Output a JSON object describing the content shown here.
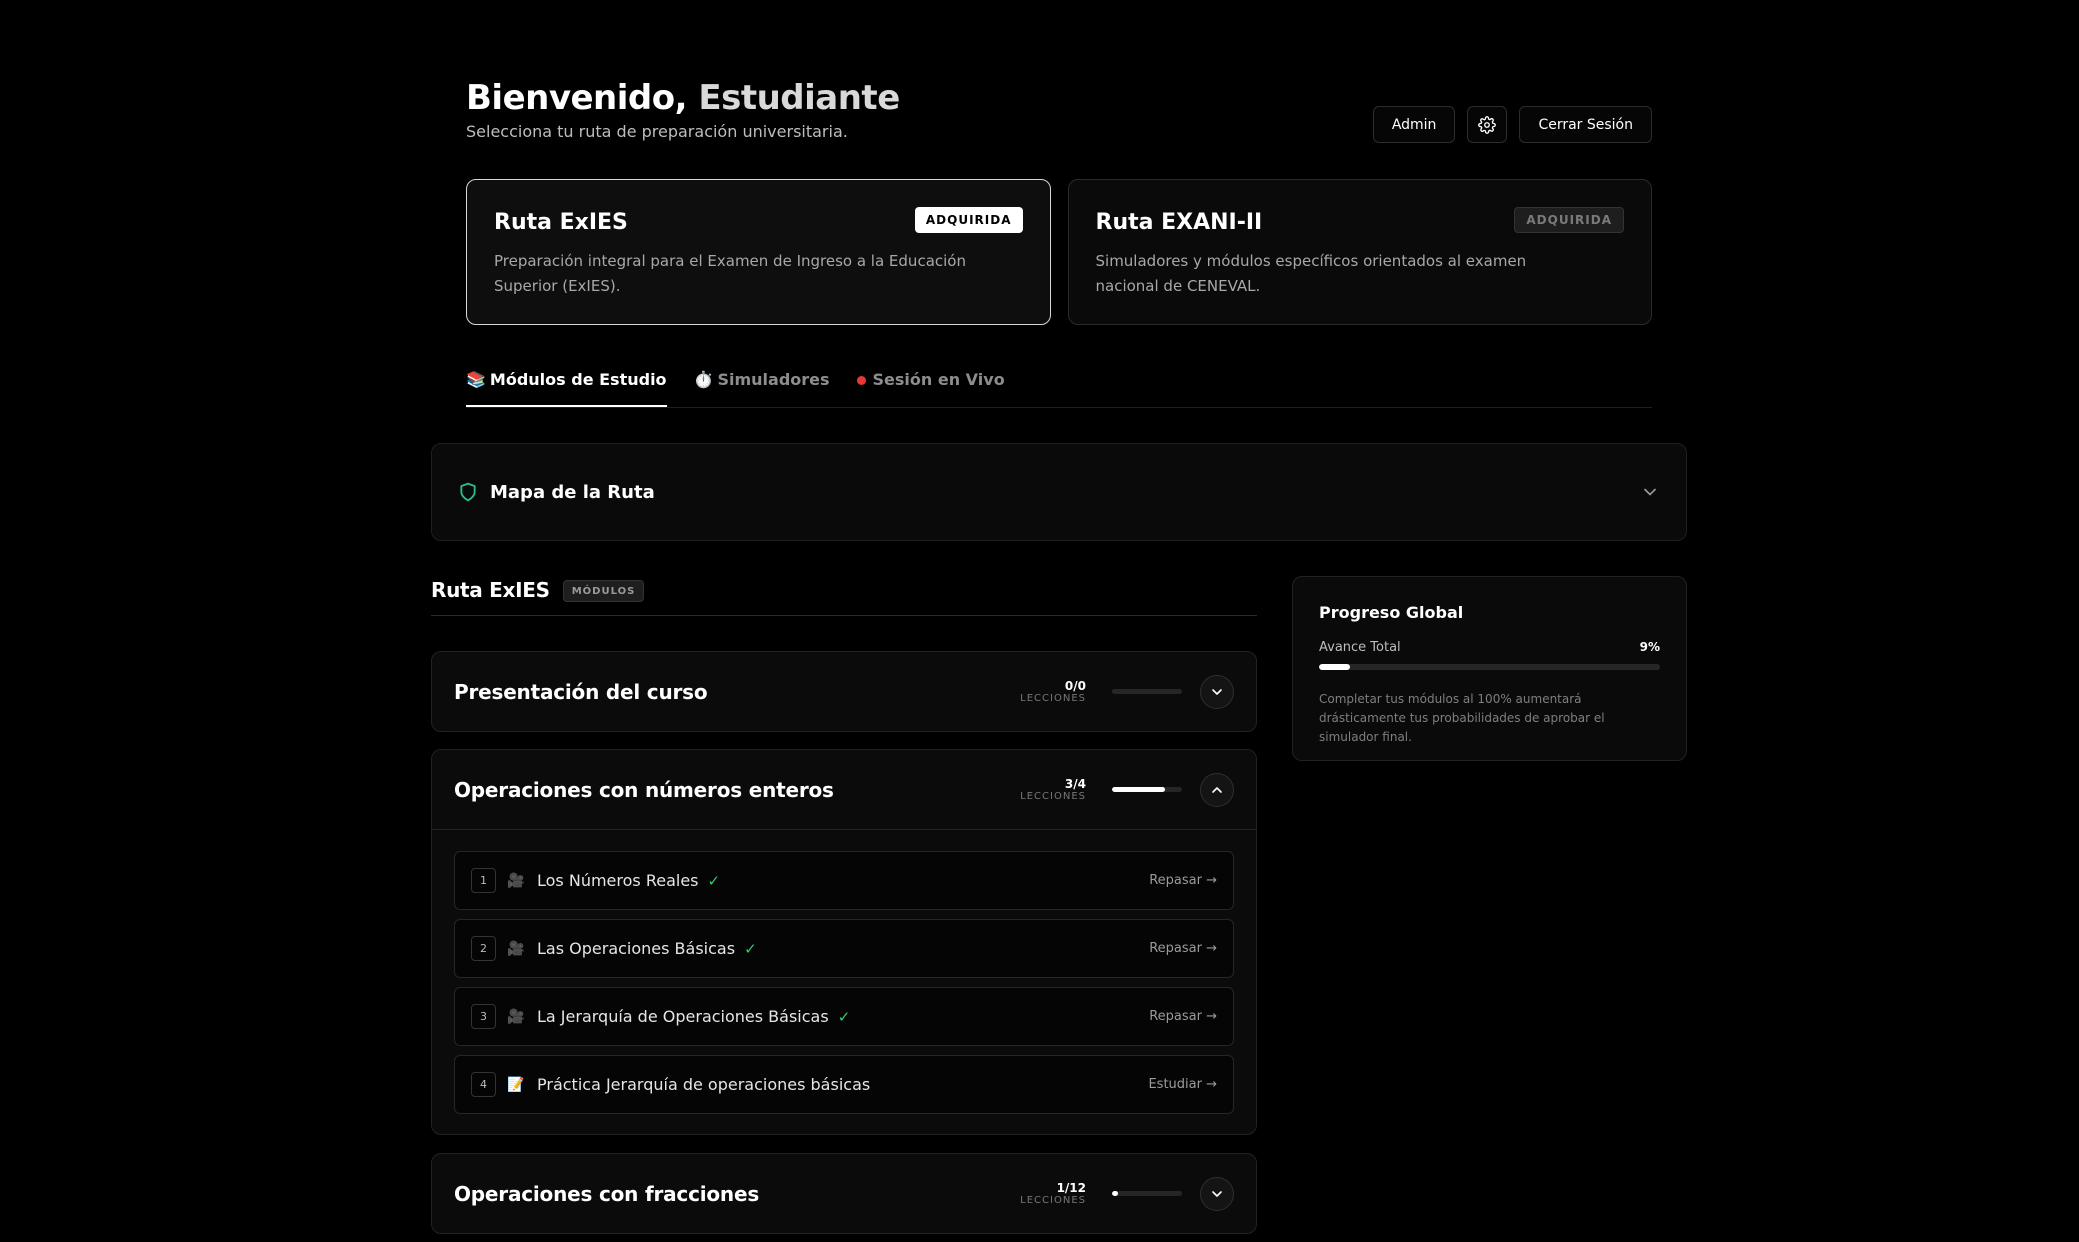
{
  "header": {
    "greeting": "Bienvenido,",
    "user_name": "Estudiante",
    "subtitle": "Selecciona tu ruta de preparación universitaria.",
    "admin_label": "Admin",
    "settings_icon": "gear-icon",
    "logout_label": "Cerrar Sesión"
  },
  "routes": [
    {
      "title": "Ruta ExIES",
      "description": "Preparación integral para el Examen de Ingreso a la Educación Superior (ExIES).",
      "badge": "ADQUIRIDA"
    },
    {
      "title": "Ruta EXANI-II",
      "description": "Simuladores y módulos específicos orientados al examen nacional de CENEVAL.",
      "badge": "ADQUIRIDA"
    }
  ],
  "tabs": [
    {
      "icon": "📚",
      "label": "Módulos de Estudio"
    },
    {
      "icon": "⏱️",
      "label": "Simuladores"
    },
    {
      "icon": "live-dot",
      "label": "Sesión en Vivo"
    }
  ],
  "map": {
    "title": "Mapa de la Ruta",
    "icon": "shield-icon"
  },
  "section": {
    "title": "Ruta ExIES",
    "tag": "MÓDULOS"
  },
  "modules": [
    {
      "title": "Presentación del curso",
      "count": "0/0",
      "count_label": "LECCIONES",
      "progress": 0,
      "expanded": false
    },
    {
      "title": "Operaciones con números enteros",
      "count": "3/4",
      "count_label": "LECCIONES",
      "progress": 0.75,
      "expanded": true,
      "lessons": [
        {
          "num": "1",
          "icon": "🎥",
          "title": "Los Números Reales",
          "done": true,
          "action": "Repasar →"
        },
        {
          "num": "2",
          "icon": "🎥",
          "title": "Las Operaciones Básicas",
          "done": true,
          "action": "Repasar →"
        },
        {
          "num": "3",
          "icon": "🎥",
          "title": "La Jerarquía de Operaciones Básicas",
          "done": true,
          "action": "Repasar →"
        },
        {
          "num": "4",
          "icon": "📝",
          "title": "Práctica Jerarquía de operaciones básicas",
          "done": false,
          "action": "Estudiar →"
        }
      ]
    },
    {
      "title": "Operaciones con fracciones",
      "count": "1/12",
      "count_label": "LECCIONES",
      "progress": 0.083,
      "expanded": false
    }
  ],
  "global_progress": {
    "title": "Progreso Global",
    "label": "Avance Total",
    "percent_text": "9%",
    "percent": 9,
    "note": "Completar tus módulos al 100% aumentará drásticamente tus probabilidades de aprobar el simulador final."
  },
  "colors": {
    "background": "#000000",
    "check": "#2ecc71",
    "live": "#e53935",
    "shield": "#27c08a"
  }
}
